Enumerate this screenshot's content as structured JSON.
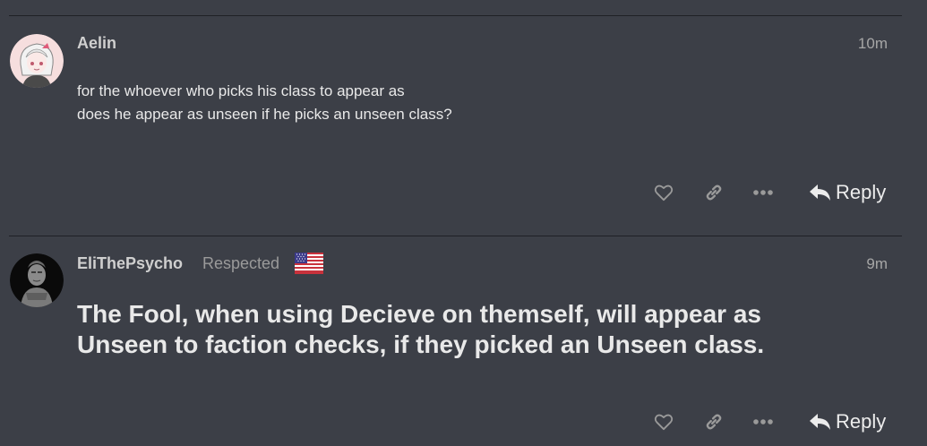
{
  "posts": [
    {
      "username": "Aelin",
      "user_title": "",
      "timestamp": "10m",
      "avatar_icon": "anime-avatar-icon",
      "body_lines": [
        "for the whoever who picks his class to appear as",
        "does he appear as unseen if he picks an unseen class?"
      ],
      "reply_label": "Reply"
    },
    {
      "username": "EliThePsycho",
      "user_title": "Respected",
      "flag": "us-flag-icon",
      "timestamp": "9m",
      "avatar_icon": "terracotta-warrior-avatar-icon",
      "body_lines": [
        "The Fool, when using Decieve on themself, will appear as",
        "Unseen to faction checks, if they picked an Unseen class."
      ],
      "reply_label": "Reply"
    }
  ],
  "colors": {
    "background": "#3c3f47",
    "divider": "#1f2126",
    "text": "#e9e9e9",
    "muted": "#a6a6a6"
  }
}
